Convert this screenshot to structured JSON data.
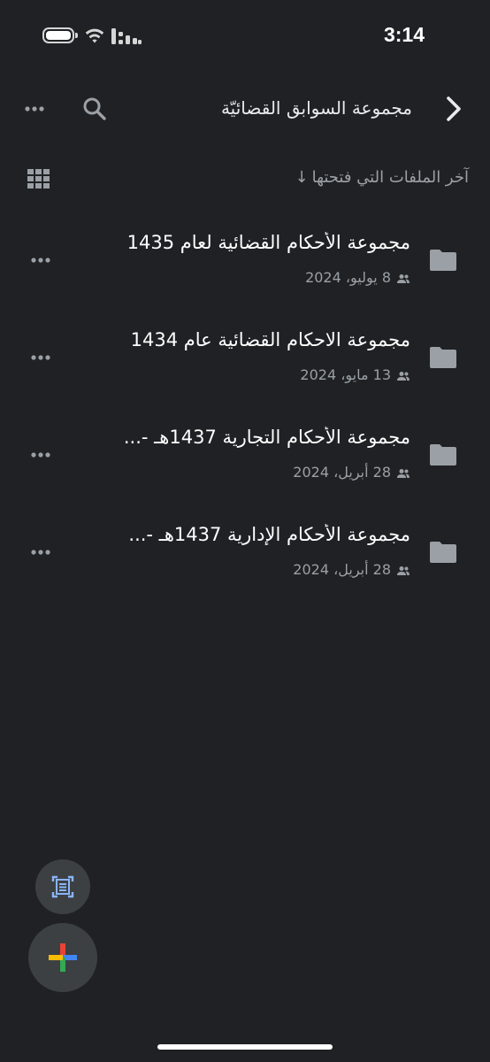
{
  "status_bar": {
    "time": "3:14"
  },
  "app_bar": {
    "title": "مجموعة السوابق القضائيّة",
    "icons": {
      "back": "chevron-right-icon",
      "search": "search-icon",
      "more": "more-horizontal-icon"
    }
  },
  "sort": {
    "label": "آخر الملفات التي فتحتها",
    "arrow": "↓",
    "view_toggle_icon": "grid-view-icon"
  },
  "files": [
    {
      "name": "مجموعة الأحكام القضائية لعام 1435",
      "date": "8 يوليو، 2024"
    },
    {
      "name": "مجموعة الاحكام القضائية عام 1434",
      "date": "13 مايو، 2024"
    },
    {
      "name": "مجموعة الأحكام التجارية 1437هـ -...",
      "date": "28 أبريل، 2024"
    },
    {
      "name": "مجموعة الأحكام الإدارية 1437هـ -...",
      "date": "28 أبريل، 2024"
    }
  ],
  "fabs": {
    "scan_icon": "document-scan-icon",
    "new_icon": "plus-icon"
  },
  "colors": {
    "background": "#202124",
    "text_primary": "#ffffff",
    "text_secondary": "#9aa0a6",
    "fab_background": "#3c4043",
    "google_blue": "#4285f4",
    "google_red": "#ea4335",
    "google_yellow": "#fbbc04",
    "google_green": "#34a853"
  }
}
